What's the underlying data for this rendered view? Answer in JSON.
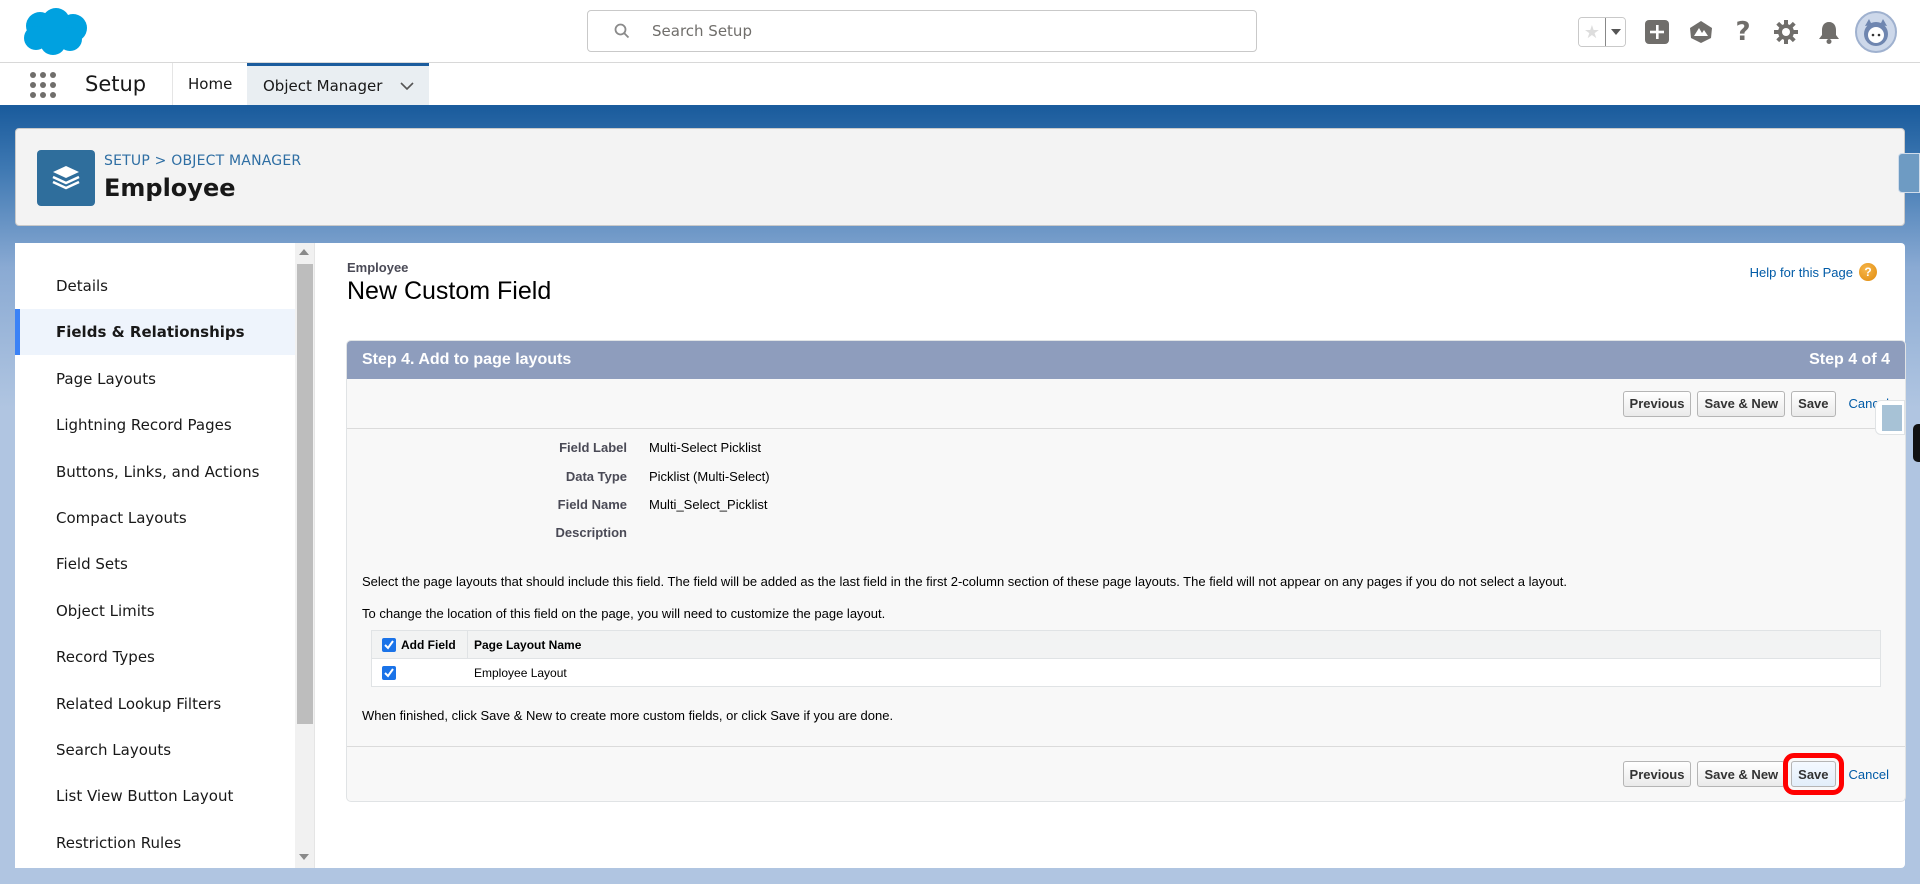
{
  "header": {
    "logo": "salesforce-cloud-logo",
    "search_placeholder": "Search Setup",
    "icons": [
      "favorites-star-icon",
      "favorites-dropdown-icon",
      "global-actions-plus-icon",
      "trailhead-icon",
      "help-question-icon",
      "setup-gear-icon",
      "notifications-bell-icon",
      "user-avatar"
    ]
  },
  "nav": {
    "app_name": "Setup",
    "tabs": [
      {
        "label": "Home"
      },
      {
        "label": "Object Manager"
      }
    ]
  },
  "object_header": {
    "breadcrumb_setup": "SETUP",
    "breadcrumb_sep": ">",
    "breadcrumb_om": "OBJECT MANAGER",
    "title": "Employee"
  },
  "sidebar": {
    "items": [
      {
        "label": "Details"
      },
      {
        "label": "Fields & Relationships",
        "active": true
      },
      {
        "label": "Page Layouts"
      },
      {
        "label": "Lightning Record Pages"
      },
      {
        "label": "Buttons, Links, and Actions"
      },
      {
        "label": "Compact Layouts"
      },
      {
        "label": "Field Sets"
      },
      {
        "label": "Object Limits"
      },
      {
        "label": "Record Types"
      },
      {
        "label": "Related Lookup Filters"
      },
      {
        "label": "Search Layouts"
      },
      {
        "label": "List View Button Layout"
      },
      {
        "label": "Restriction Rules"
      }
    ]
  },
  "content": {
    "context_label": "Employee",
    "page_title": "New Custom Field",
    "help_link": "Help for this Page",
    "step_title": "Step 4. Add to page layouts",
    "step_counter": "Step 4 of 4",
    "buttons": {
      "previous": "Previous",
      "save_new": "Save & New",
      "save": "Save",
      "cancel": "Cancel"
    },
    "details": [
      {
        "label": "Field Label",
        "value": "Multi-Select Picklist"
      },
      {
        "label": "Data Type",
        "value": "Picklist (Multi-Select)"
      },
      {
        "label": "Field Name",
        "value": "Multi_Select_Picklist"
      },
      {
        "label": "Description",
        "value": ""
      }
    ],
    "instruction_1": "Select the page layouts that should include this field. The field will be added as the last field in the first 2-column section of these page layouts. The field will not appear on any pages if you do not select a layout.",
    "instruction_2": "To change the location of this field on the page, you will need to customize the page layout.",
    "layout_table": {
      "headers": [
        "Add Field",
        "Page Layout Name"
      ],
      "header_checked": true,
      "rows": [
        {
          "checked": true,
          "name": "Employee Layout"
        }
      ]
    },
    "finish_note": "When finished, click Save & New to create more custom fields, or click Save if you are done."
  },
  "highlight": {
    "target": "bottom-save-button",
    "color": "#ff0000"
  }
}
